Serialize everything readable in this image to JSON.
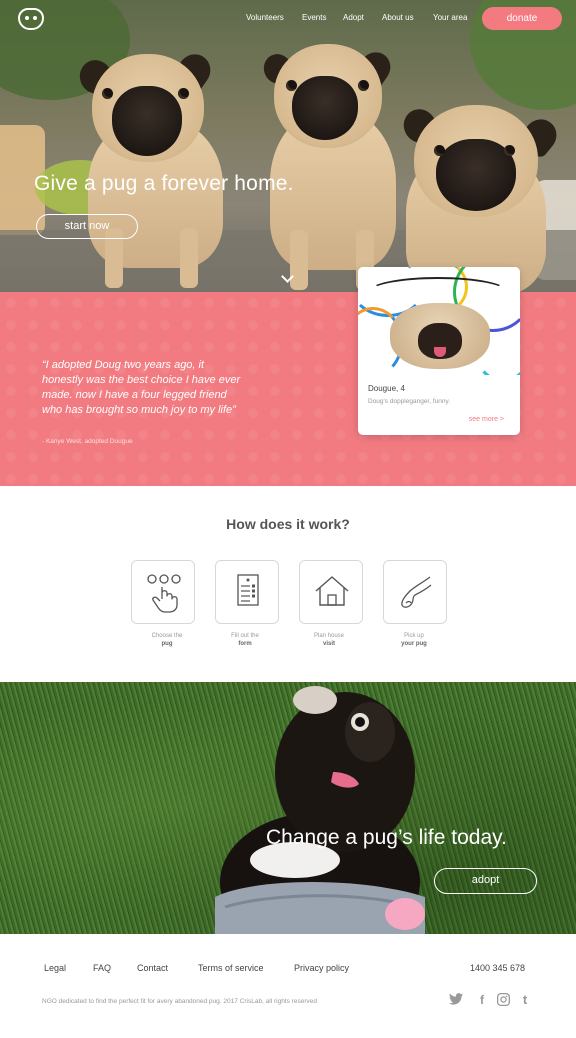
{
  "nav": {
    "items": [
      {
        "label": "Volunteers"
      },
      {
        "label": "Events"
      },
      {
        "label": "Adopt"
      },
      {
        "label": "About us"
      },
      {
        "label": "Your area"
      }
    ],
    "donate_label": "donate"
  },
  "hero": {
    "title": "Give a pug a forever home.",
    "button_label": "start now"
  },
  "testimonial": {
    "quote": "“I adopted Doug two years ago, it honestly was the best choice I have ever made. now I have a four legged friend  who has brought so much joy to my life”",
    "author": "- Kanye West, adopted Dougue"
  },
  "card": {
    "name": "Dougue, 4",
    "description": "Doug's doppleganger, funny.",
    "more_label": "see more >"
  },
  "how": {
    "title": "How does it work?",
    "steps": [
      {
        "line1": "Choose the",
        "line2": "pug",
        "icon": "hand-tap-icon"
      },
      {
        "line1": "Fill out the",
        "line2": "form",
        "icon": "form-icon"
      },
      {
        "line1": "Plan house",
        "line2": "visit",
        "icon": "house-icon"
      },
      {
        "line1": "Pick up",
        "line2": "your pug",
        "icon": "pickup-hand-icon"
      }
    ]
  },
  "cta": {
    "title": "Change a pug’s life today.",
    "button_label": "adopt"
  },
  "footer": {
    "links": [
      {
        "label": "Legal"
      },
      {
        "label": "FAQ"
      },
      {
        "label": "Contact"
      },
      {
        "label": "Terms of service"
      },
      {
        "label": "Privacy policy"
      }
    ],
    "phone": "1400 345 678",
    "copyright": "NGO dedicated to find the perfect fit for avery abandoned pug. 2017 CrisLab, all rights reserved",
    "social": [
      {
        "icon": "twitter-icon",
        "glyph": "🐦"
      },
      {
        "icon": "facebook-icon",
        "glyph": "f"
      },
      {
        "icon": "instagram-icon",
        "glyph": "◎"
      },
      {
        "icon": "tumblr-icon",
        "glyph": "t"
      }
    ]
  },
  "colors": {
    "accent": "#f17b81",
    "text": "#444444"
  }
}
